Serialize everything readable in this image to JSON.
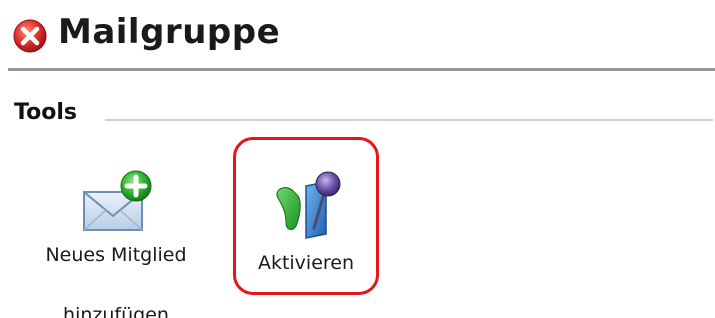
{
  "window": {
    "title": "Mailgruppe"
  },
  "section": {
    "label": "Tools"
  },
  "tools": [
    {
      "label_line1": "Neues Mitglied",
      "label_line2": "hinzufügen",
      "icon": "mail-add-icon"
    },
    {
      "label": "Aktivieren",
      "icon": "activate-icon",
      "highlighted": true
    }
  ],
  "colors": {
    "close_red": "#d9262c",
    "highlight_border": "#e8141b",
    "header_rule": "#9a948e",
    "section_rule": "#d4d0c8"
  }
}
